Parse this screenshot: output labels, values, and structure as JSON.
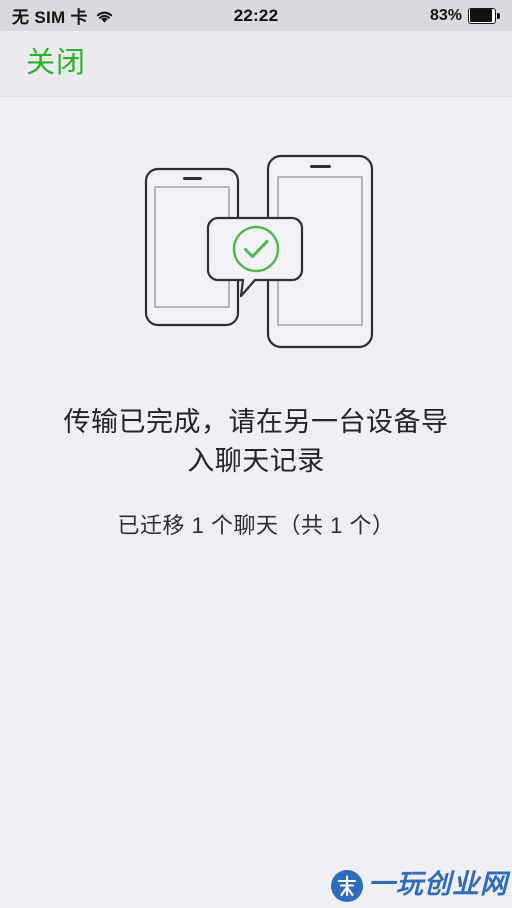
{
  "status_bar": {
    "carrier": "无 SIM 卡",
    "wifi_icon": "wifi-icon",
    "time": "22:22",
    "battery_percent": "83%",
    "battery_icon": "battery-icon",
    "battery_level": 83
  },
  "nav_bar": {
    "close_label": "关闭",
    "accent_color": "#2bb22b"
  },
  "illustration": {
    "name": "transfer-complete-illustration",
    "left_phone": "phone-outline-small",
    "right_phone": "phone-outline-large",
    "bubble": "speech-bubble",
    "check_icon": "check-circle-icon",
    "check_color": "#4eb84e",
    "outline_color": "#2e2e38"
  },
  "main": {
    "title": "传输已完成，请在另一台设备导入聊天记录",
    "subtitle": "已迁移 1 个聊天（共 1 个）",
    "migrated_count": 1,
    "total_count": 1
  },
  "watermark": {
    "text": "一玩创业网",
    "badge_icon": "brand-badge-icon",
    "color": "#1f62b8"
  }
}
